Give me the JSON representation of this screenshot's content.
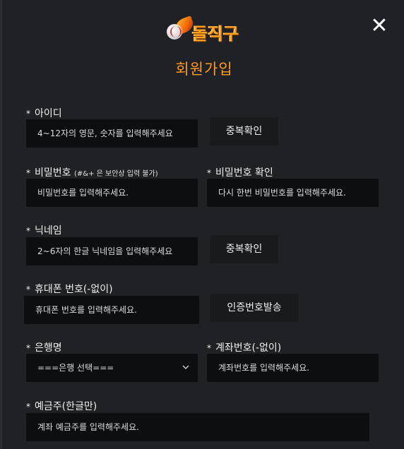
{
  "header": {
    "logo_text": "돌직구",
    "close_label": "✕",
    "title": "회원가입"
  },
  "form": {
    "id": {
      "star": "*",
      "label": "아이디",
      "placeholder": "4~12자의 영문, 숫자를 입력해주세요",
      "check_button": "중복확인"
    },
    "password": {
      "star": "*",
      "label": "비밀번호",
      "note": "(#&+ 은 보안상 입력 불가)",
      "placeholder": "비밀번호를 입력해주세요."
    },
    "password_confirm": {
      "star": "*",
      "label": "비밀번호 확인",
      "placeholder": "다시 한번 비밀번호를 입력해주세요."
    },
    "nickname": {
      "star": "*",
      "label": "닉네임",
      "placeholder": "2~6자의 한글 닉네임을 입력해주세요",
      "check_button": "중복확인"
    },
    "phone": {
      "star": "*",
      "label": "휴대폰 번호(-없이)",
      "placeholder": "휴대폰 번호를 입력해주세요.",
      "send_button": "인증번호발송"
    },
    "bank": {
      "star": "*",
      "label": "은행명",
      "selected": "===은행 선택==="
    },
    "account": {
      "star": "*",
      "label": "계좌번호(-없이)",
      "placeholder": "계좌번호를 입력해주세요."
    },
    "holder": {
      "star": "*",
      "label": "예금주(한글만)",
      "placeholder": "계좌 예금주를 입력해주세요."
    }
  }
}
